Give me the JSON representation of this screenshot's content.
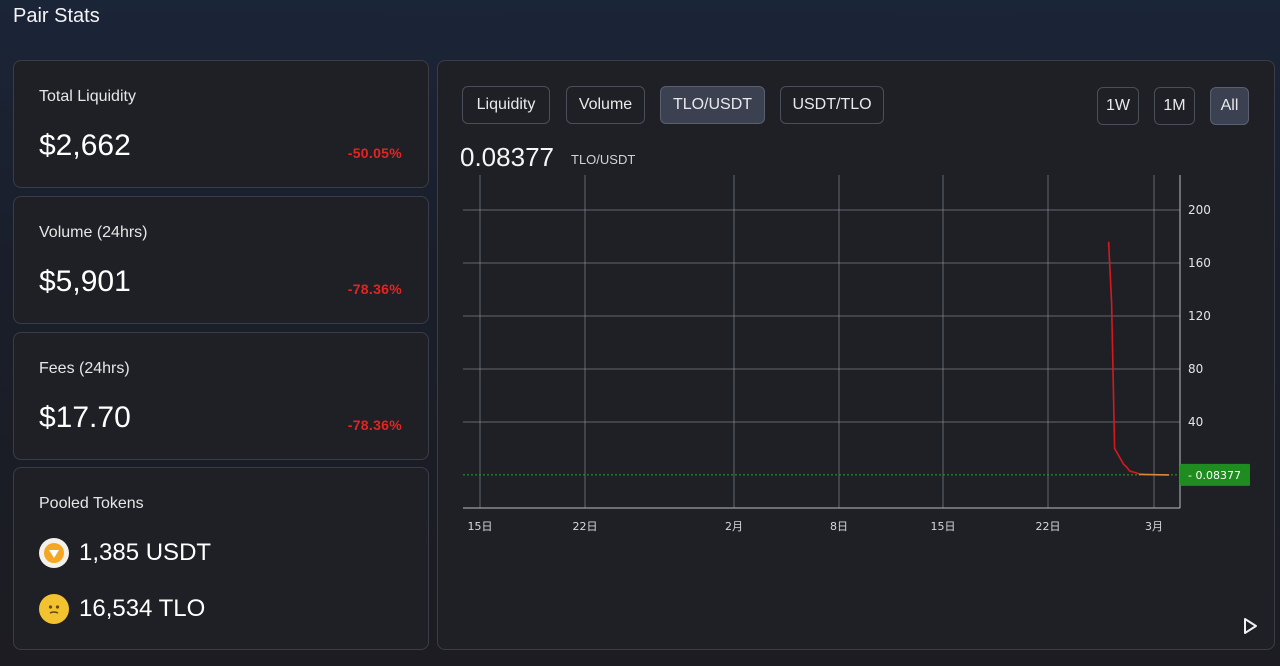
{
  "page_title": "Pair Stats",
  "stats": [
    {
      "label": "Total Liquidity",
      "value": "$2,662",
      "change": "-50.05%"
    },
    {
      "label": "Volume (24hrs)",
      "value": "$5,901",
      "change": "-78.36%"
    },
    {
      "label": "Fees (24hrs)",
      "value": "$17.70",
      "change": "-78.36%"
    }
  ],
  "pooled": {
    "label": "Pooled Tokens",
    "tokens": [
      {
        "amount": "1,385 USDT",
        "icon": "usdt-token-icon",
        "color": "#f5a623"
      },
      {
        "amount": "16,534 TLO",
        "icon": "tlo-token-icon",
        "color": "#f2c230"
      }
    ]
  },
  "chart_tabs": [
    "Liquidity",
    "Volume",
    "TLO/USDT",
    "USDT/TLO"
  ],
  "active_tab": "TLO/USDT",
  "ranges": [
    "1W",
    "1M",
    "All"
  ],
  "active_range": "All",
  "price": {
    "value": "0.08377",
    "unit": "TLO/USDT"
  },
  "chart_data": {
    "type": "line",
    "title": "",
    "xlabel": "",
    "ylabel": "",
    "x_ticks": [
      "15日",
      "22日",
      "2月",
      "8日",
      "15日",
      "22日",
      "3月"
    ],
    "y_ticks": [
      "200",
      "160",
      "120",
      "80",
      "40"
    ],
    "ylim": [
      0,
      210
    ],
    "grid": true,
    "series": [
      {
        "color": "#d7191c",
        "x": [
          "2/26",
          "2/26",
          "2/26",
          "2/27",
          "2/27",
          "2/27",
          "2/28"
        ],
        "y": [
          176,
          130,
          20,
          8,
          6,
          3,
          1
        ]
      },
      {
        "color": "#d88a3a",
        "x": [
          "2/28",
          "3/1",
          "3/2"
        ],
        "y": [
          0.5,
          0.2,
          0.08377
        ]
      }
    ],
    "current_value_label": "0.08377",
    "current_value_color": "#1e8c1e"
  }
}
